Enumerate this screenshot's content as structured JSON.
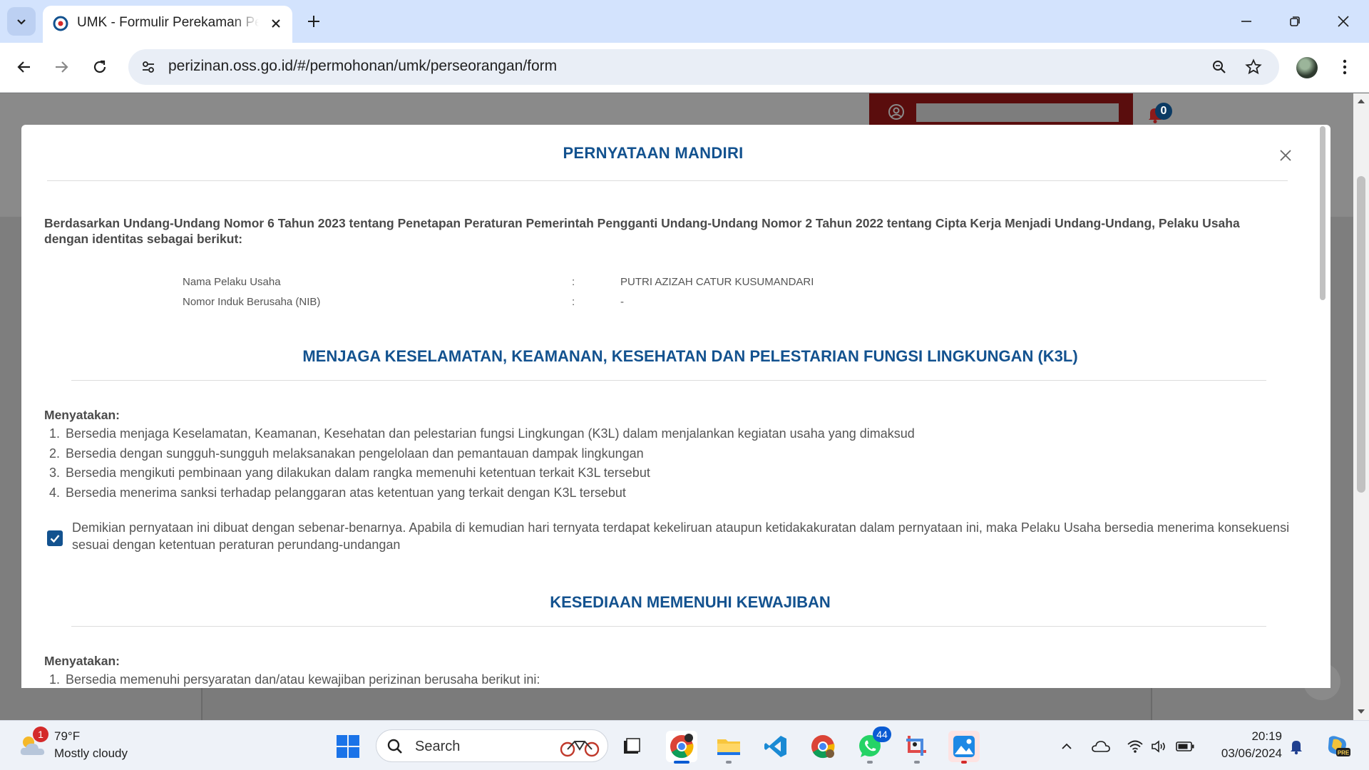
{
  "browser": {
    "tab_title": "UMK - Formulir Perekaman Pelaku Usaha",
    "url": "perizinan.oss.go.id/#/permohonan/umk/perseorangan/form"
  },
  "page": {
    "notification_count": "0"
  },
  "modal": {
    "title": "PERNYATAAN MANDIRI",
    "intro": "Berdasarkan Undang-Undang Nomor 6 Tahun 2023 tentang Penetapan Peraturan Pemerintah Pengganti Undang-Undang Nomor 2 Tahun 2022 tentang Cipta Kerja Menjadi Undang-Undang, Pelaku Usaha dengan identitas sebagai berikut:",
    "identity": [
      {
        "label": "Nama Pelaku Usaha",
        "colon": ":",
        "value": "PUTRI AZIZAH CATUR KUSUMANDARI"
      },
      {
        "label": "Nomor Induk Berusaha (NIB)",
        "colon": ":",
        "value": "-"
      }
    ],
    "section1": {
      "title": "MENJAGA KESELAMATAN, KEAMANAN, KESEHATAN DAN PELESTARIAN FUNGSI LINGKUNGAN (K3L)",
      "label": "Menyatakan:",
      "items": [
        {
          "num": "1.",
          "text": "Bersedia menjaga Keselamatan, Keamanan, Kesehatan dan pelestarian fungsi Lingkungan (K3L) dalam menjalankan kegiatan usaha yang dimaksud"
        },
        {
          "num": "2.",
          "text": "Bersedia dengan sungguh-sungguh melaksanakan pengelolaan dan pemantauan dampak lingkungan"
        },
        {
          "num": "3.",
          "text": "Bersedia mengikuti pembinaan yang dilakukan dalam rangka memenuhi ketentuan terkait K3L tersebut"
        },
        {
          "num": "4.",
          "text": "Bersedia menerima sanksi terhadap pelanggaran atas ketentuan yang terkait dengan K3L tersebut"
        }
      ],
      "declaration_checked": true,
      "declaration": "Demikian pernyataan ini dibuat dengan sebenar-benarnya. Apabila di kemudian hari ternyata terdapat kekeliruan ataupun ketidakakuratan dalam pernyataan ini, maka Pelaku Usaha bersedia menerima konsekuensi sesuai dengan ketentuan peraturan perundang-undangan"
    },
    "section2": {
      "title": "KESEDIAAN MEMENUHI KEWAJIBAN",
      "label": "Menyatakan:",
      "items": [
        {
          "num": "1.",
          "text": "Bersedia memenuhi persyaratan dan/atau kewajiban perizinan berusaha berikut ini:"
        }
      ]
    }
  },
  "taskbar": {
    "weather_badge": "1",
    "weather_temp": "79°F",
    "weather_desc": "Mostly cloudy",
    "search_placeholder": "Search",
    "whatsapp_badge": "44",
    "time": "20:19",
    "date": "03/06/2024"
  },
  "colors": {
    "accent_blue": "#13528f",
    "chrome_tabbar": "#d3e3fd",
    "dimmed_overlay": "#7e7e7e"
  }
}
